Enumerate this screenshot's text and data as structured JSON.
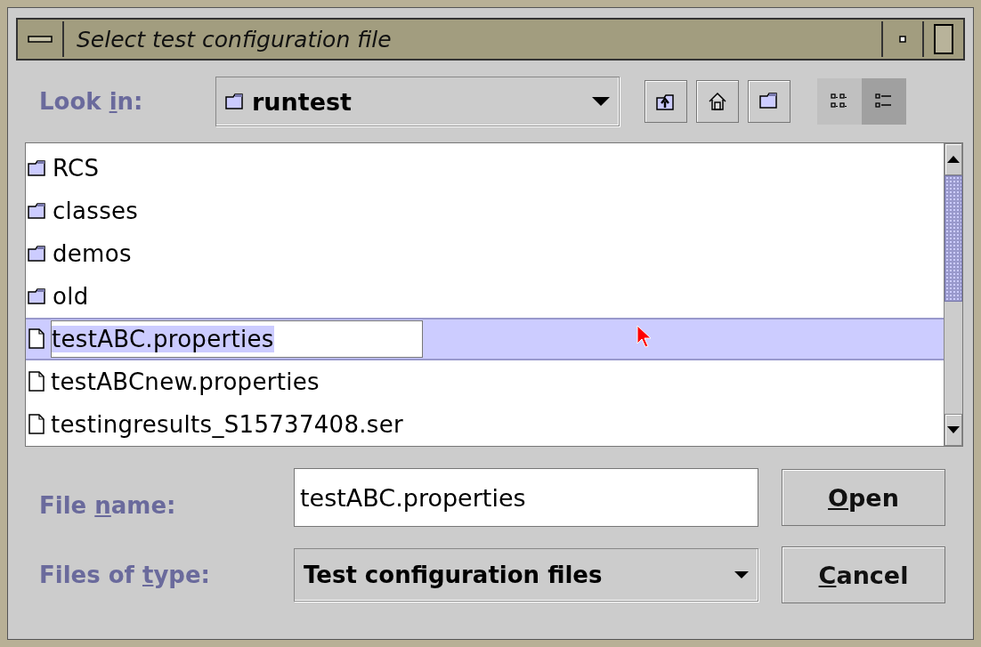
{
  "window": {
    "title": "Select test configuration file"
  },
  "look_in": {
    "label": {
      "before": "Look ",
      "key": "i",
      "after": "n:"
    },
    "value": "runtest"
  },
  "toolbar": [
    {
      "kind": "up"
    },
    {
      "kind": "home"
    },
    {
      "kind": "newfolder"
    },
    {
      "kind": "list",
      "selected": false
    },
    {
      "kind": "details",
      "selected": true
    }
  ],
  "files": [
    {
      "name": "RCS",
      "kind": "folder",
      "selected": false,
      "editing": false
    },
    {
      "name": "classes",
      "kind": "folder",
      "selected": false,
      "editing": false
    },
    {
      "name": "demos",
      "kind": "folder",
      "selected": false,
      "editing": false
    },
    {
      "name": "old",
      "kind": "folder",
      "selected": false,
      "editing": false
    },
    {
      "name": "testABC.properties",
      "kind": "file",
      "selected": true,
      "editing": true
    },
    {
      "name": "testABCnew.properties",
      "kind": "file",
      "selected": false,
      "editing": false
    },
    {
      "name": "testingresults_S15737408.ser",
      "kind": "file",
      "selected": false,
      "editing": false
    }
  ],
  "file_name": {
    "label": {
      "before": "File ",
      "key": "n",
      "after": "ame:"
    },
    "value": "testABC.properties"
  },
  "files_of_type": {
    "label": {
      "before": "Files of ",
      "key": "t",
      "after": "ype:"
    },
    "value": "Test configuration files"
  },
  "buttons": [
    {
      "key": "O",
      "after": "pen"
    },
    {
      "key": "C",
      "after": "ancel"
    }
  ]
}
